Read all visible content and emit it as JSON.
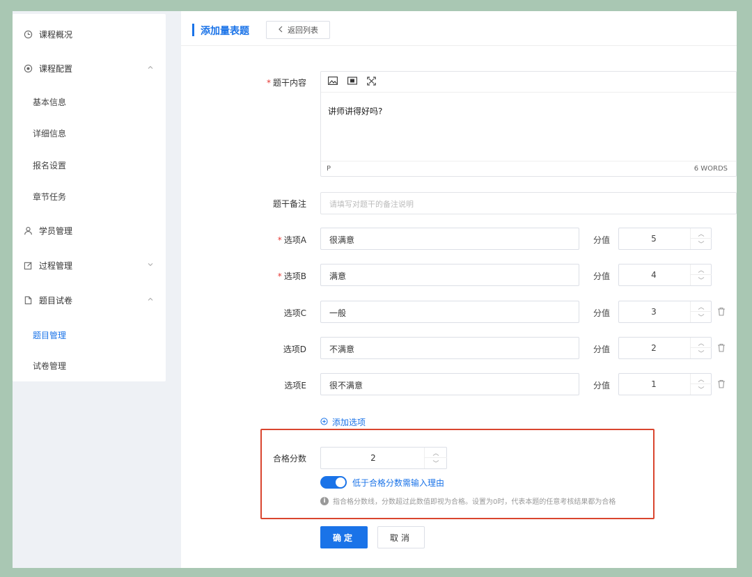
{
  "sidebar": {
    "items": [
      {
        "label": "课程概况",
        "icon": "clock-icon"
      },
      {
        "label": "课程配置",
        "icon": "target-icon"
      },
      {
        "label": "学员管理",
        "icon": "user-icon"
      },
      {
        "label": "过程管理",
        "icon": "edit-icon"
      },
      {
        "label": "题目试卷",
        "icon": "document-icon"
      }
    ],
    "config_sub": [
      "基本信息",
      "详细信息",
      "报名设置",
      "章节任务"
    ],
    "exam_sub": [
      "题目管理",
      "试卷管理"
    ],
    "active": "题目管理"
  },
  "header": {
    "title": "添加量表题",
    "back_label": "返回列表"
  },
  "form": {
    "stem_label": "题干内容",
    "stem_text": "讲师讲得好吗?",
    "editor_tag": "P",
    "word_count": "6 WORDS",
    "note_label": "题干备注",
    "note_placeholder": "请填写对题干的备注说明",
    "score_label": "分值",
    "options": [
      {
        "label": "选项A",
        "value": "很满意",
        "score": "5",
        "required": true
      },
      {
        "label": "选项B",
        "value": "满意",
        "score": "4",
        "required": true
      },
      {
        "label": "选项C",
        "value": "一般",
        "score": "3",
        "required": false
      },
      {
        "label": "选项D",
        "value": "不满意",
        "score": "2",
        "required": false
      },
      {
        "label": "选项E",
        "value": "很不满意",
        "score": "1",
        "required": false
      }
    ],
    "add_option": "添加选项",
    "pass_label": "合格分数",
    "pass_value": "2",
    "toggle_label": "低于合格分数需输入理由",
    "toggle_on": true,
    "hint": "指合格分数线，分数超过此数值即视为合格。设置为0时，代表本题的任意考核结果都为合格",
    "confirm": "确定",
    "cancel": "取消"
  },
  "colors": {
    "accent": "#1a73e8",
    "highlight_border": "#d9452e",
    "background": "#a9c7b3"
  }
}
